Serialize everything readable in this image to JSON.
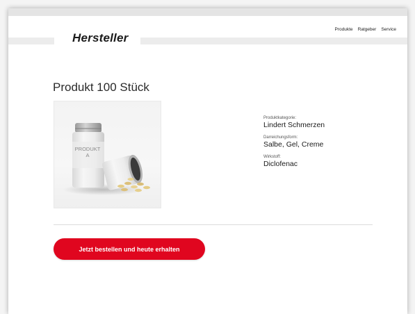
{
  "brand": {
    "logo_text": "Hersteller"
  },
  "nav": [
    {
      "label": "Produkte"
    },
    {
      "label": "Ratgeber"
    },
    {
      "label": "Service"
    }
  ],
  "product": {
    "title": "Produkt 100 Stück",
    "image_label_line1": "PRODUKT",
    "image_label_line2": "A",
    "specs": [
      {
        "label": "Produktkategorie:",
        "value": "Lindert Schmerzen"
      },
      {
        "label": "Darreichungsform:",
        "value": "Salbe, Gel, Creme"
      },
      {
        "label": "Wirkstoff:",
        "value": "Diclofenac"
      }
    ]
  },
  "cta": {
    "label": "Jetzt bestellen und heute erhalten"
  },
  "colors": {
    "accent": "#e0061f",
    "text": "#1a1a1a"
  }
}
